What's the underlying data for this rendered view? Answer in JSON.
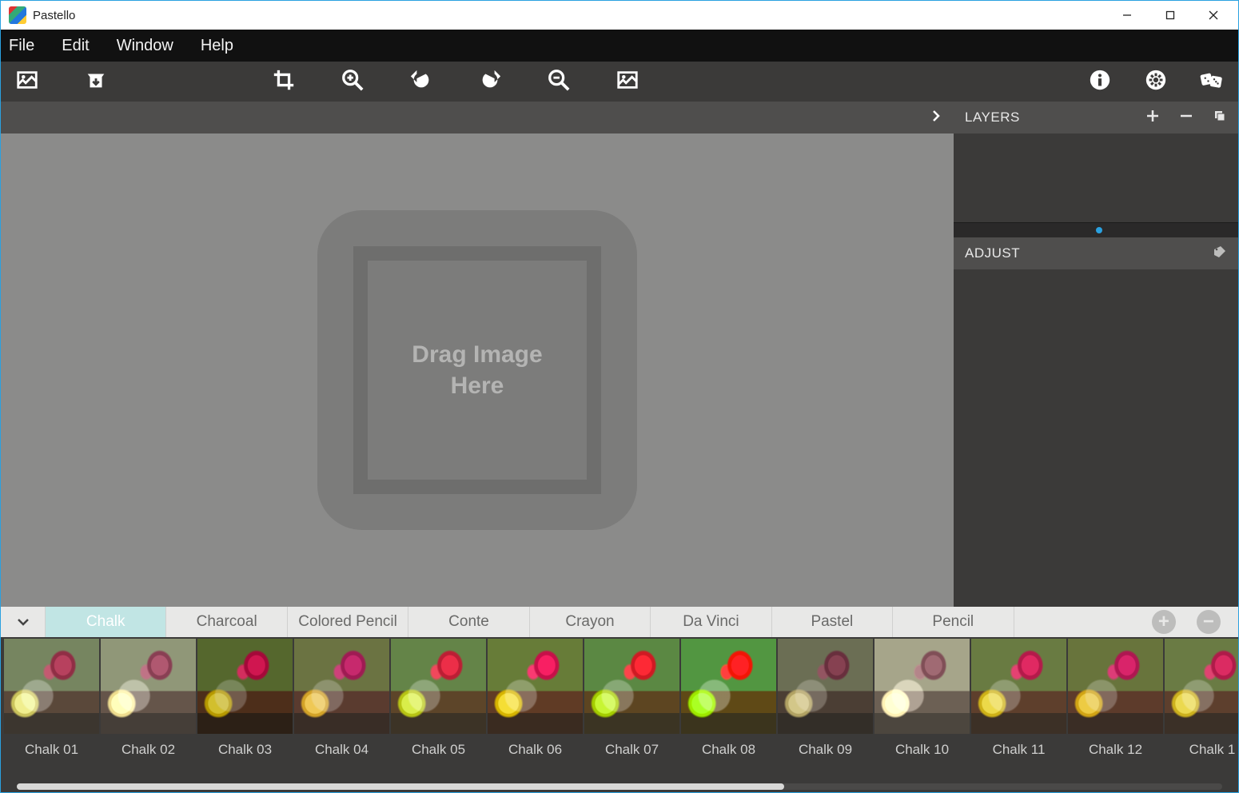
{
  "app": {
    "title": "Pastello"
  },
  "menubar": [
    "File",
    "Edit",
    "Window",
    "Help"
  ],
  "canvas": {
    "drop_line1": "Drag Image",
    "drop_line2": "Here"
  },
  "panels": {
    "layers": {
      "title": "LAYERS"
    },
    "adjust": {
      "title": "ADJUST"
    }
  },
  "preset_tabs": [
    "Chalk",
    "Charcoal",
    "Colored Pencil",
    "Conte",
    "Crayon",
    "Da Vinci",
    "Pastel",
    "Pencil"
  ],
  "active_tab_index": 0,
  "thumbs": [
    {
      "label": "Chalk 01"
    },
    {
      "label": "Chalk 02"
    },
    {
      "label": "Chalk 03"
    },
    {
      "label": "Chalk 04"
    },
    {
      "label": "Chalk 05"
    },
    {
      "label": "Chalk 06"
    },
    {
      "label": "Chalk 07"
    },
    {
      "label": "Chalk 08"
    },
    {
      "label": "Chalk 09"
    },
    {
      "label": "Chalk 10"
    },
    {
      "label": "Chalk 11"
    },
    {
      "label": "Chalk 12"
    },
    {
      "label": "Chalk 1"
    }
  ]
}
